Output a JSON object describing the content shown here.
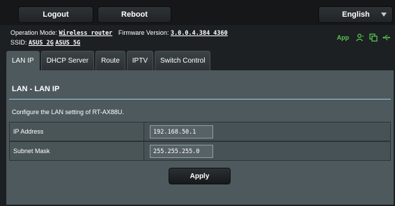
{
  "header": {
    "logout_label": "Logout",
    "reboot_label": "Reboot",
    "language": "English"
  },
  "info": {
    "operation_mode_label": "Operation Mode:",
    "operation_mode": "Wireless router",
    "firmware_label": "Firmware Version:",
    "firmware": "3.0.0.4.384_4360",
    "ssid_label": "SSID:",
    "ssid_2g": "ASUS_2G",
    "ssid_5g": "ASUS_5G",
    "app_label": "App"
  },
  "status_icons": [
    "user-icon",
    "copy-icon",
    "usb-icon"
  ],
  "accent_color": "#59c34f",
  "tabs": [
    {
      "label": "LAN IP",
      "active": true
    },
    {
      "label": "DHCP Server",
      "active": false
    },
    {
      "label": "Route",
      "active": false
    },
    {
      "label": "IPTV",
      "active": false
    },
    {
      "label": "Switch Control",
      "active": false
    }
  ],
  "page": {
    "title": "LAN - LAN IP",
    "description": "Configure the LAN setting of RT-AX88U.",
    "fields": [
      {
        "label": "IP Address",
        "value": "192.168.50.1"
      },
      {
        "label": "Subnet Mask",
        "value": "255.255.255.0"
      }
    ],
    "apply_label": "Apply"
  }
}
